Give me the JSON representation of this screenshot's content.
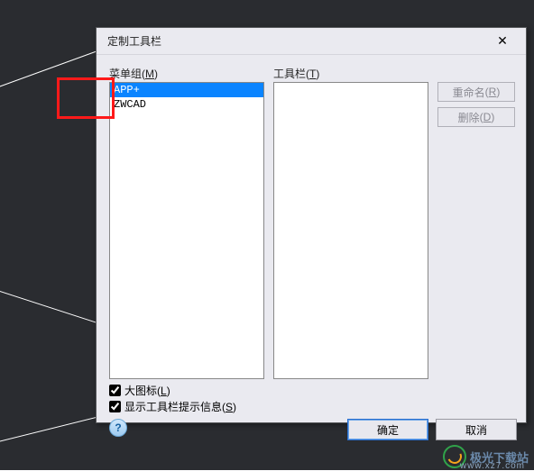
{
  "dialog": {
    "title": "定制工具栏",
    "close_glyph": "✕",
    "labels": {
      "menu_group": "菜单组",
      "menu_group_key": "M",
      "toolbar": "工具栏",
      "toolbar_key": "T"
    },
    "menu_groups": [
      "APP+",
      "ZWCAD"
    ],
    "toolbars": [],
    "buttons": {
      "rename": "重命名",
      "rename_key": "R",
      "delete": "删除",
      "delete_key": "D",
      "ok": "确定",
      "cancel": "取消"
    },
    "checkboxes": {
      "large_icons": "大图标",
      "large_icons_key": "L",
      "show_tips": "显示工具栏提示信息",
      "show_tips_key": "S"
    },
    "help_glyph": "?"
  },
  "watermark": {
    "name": "极光下载站",
    "domain": "www.xz7.com"
  }
}
